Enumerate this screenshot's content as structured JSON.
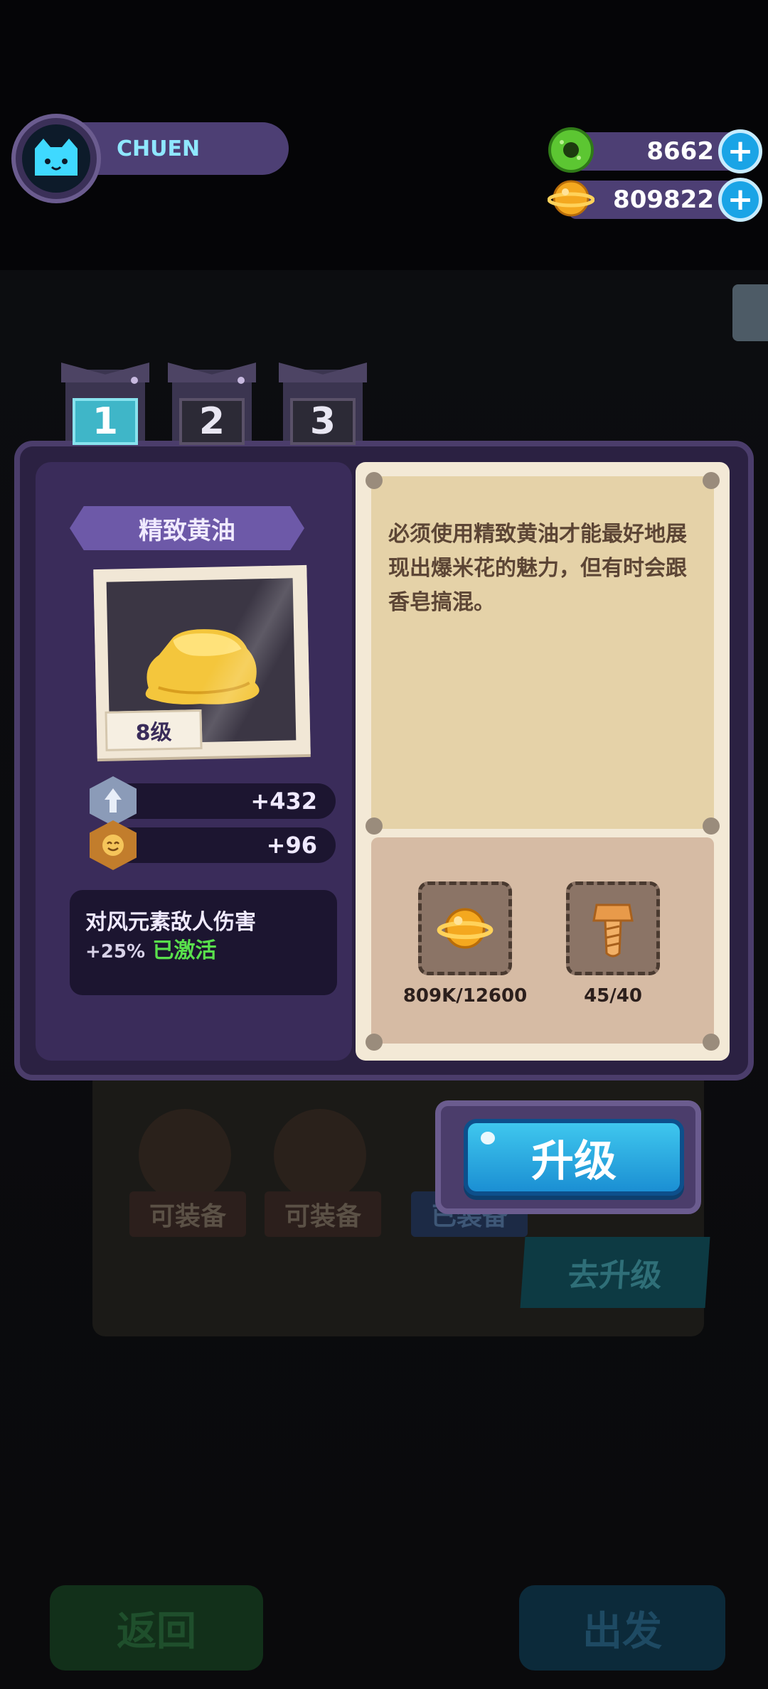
{
  "player": {
    "name": "CHUEN"
  },
  "currencies": [
    {
      "icon": "green-donut-coin-icon",
      "value": "8662",
      "color": "#5cc632"
    },
    {
      "icon": "gold-planet-coin-icon",
      "value": "809822",
      "color": "#f4a81f"
    }
  ],
  "tabs": [
    {
      "label": "1",
      "active": true
    },
    {
      "label": "2",
      "active": false
    },
    {
      "label": "3",
      "active": false
    }
  ],
  "item": {
    "name": "精致黄油",
    "level": "8级",
    "stats": [
      {
        "icon": "attack-arrow-icon",
        "value": "+432"
      },
      {
        "icon": "smile-hex-icon",
        "value": "+96"
      }
    ],
    "effect": {
      "text": "对风元素敌人伤害",
      "bonus": "+25%",
      "status": "已激活"
    },
    "description": "必须使用精致黄油才能最好地展现出爆米花的魅力，但有时会跟香皂搞混。"
  },
  "costs": [
    {
      "icon": "gold-planet-coin-icon",
      "amount": "809K/12600"
    },
    {
      "icon": "bolt-screw-icon",
      "amount": "45/40"
    }
  ],
  "upgrade_button": {
    "label": "升级"
  },
  "background": {
    "badges": [
      "可装备",
      "可装备",
      "已装备"
    ],
    "go_upgrade": "去升级",
    "back": "返回",
    "depart": "出发"
  }
}
